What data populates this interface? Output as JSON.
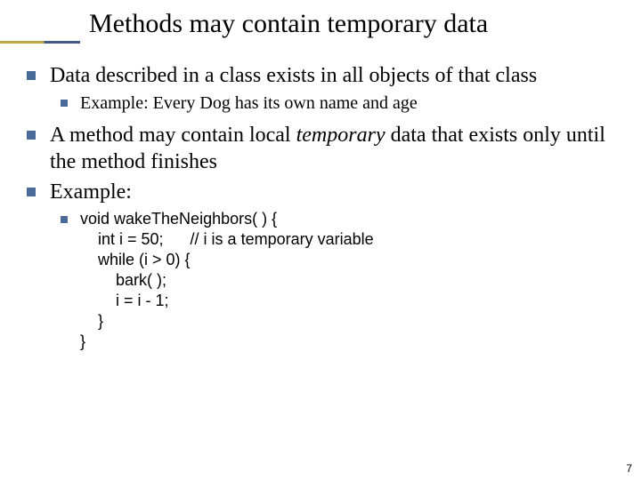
{
  "title": "Methods may contain temporary data",
  "bullets": {
    "b1": "Data described in a class exists in all objects of that class",
    "b1_1": "Example: Every Dog has its own name and age",
    "b2_pre": "A method may contain local ",
    "b2_em": "temporary",
    "b2_post": " data that exists only until the method finishes",
    "b3": "Example:"
  },
  "code": {
    "l1": "void wakeTheNeighbors( ) {",
    "l2": "    int i = 50;      // i is a temporary variable",
    "l3": "    while (i > 0) {",
    "l4": "        bark( );",
    "l5": "        i = i - 1;",
    "l6": "    }",
    "l7": "}"
  },
  "page_number": "7"
}
